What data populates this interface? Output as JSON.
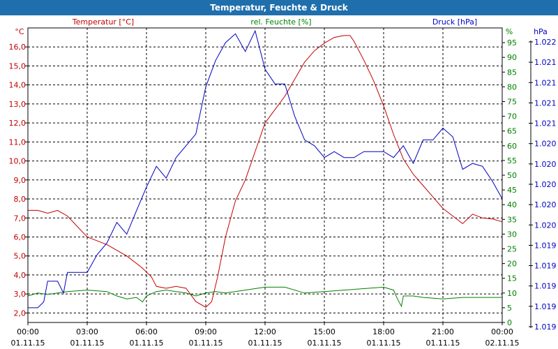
{
  "window": {
    "title": "Temperatur, Feuchte & Druck"
  },
  "colors": {
    "temperature": "#c00000",
    "humidity": "#008000",
    "pressure": "#0000c0",
    "grid": "#000000"
  },
  "chart_data": {
    "type": "line",
    "title": "Temperatur, Feuchte & Druck",
    "grid": true,
    "x_tick_times": [
      "00:00",
      "03:00",
      "06:00",
      "09:00",
      "12:00",
      "15:00",
      "18:00",
      "21:00",
      "00:00"
    ],
    "x_tick_dates": [
      "01.11.15",
      "01.11.15",
      "01.11.15",
      "01.11.15",
      "01.11.15",
      "01.11.15",
      "01.11.15",
      "01.11.15",
      "02.11.15"
    ],
    "x_range_hours": [
      0,
      24
    ],
    "axes": {
      "temperature": {
        "unit": "°C",
        "label": "Temperatur [°C]",
        "range": [
          1.5,
          17.0
        ],
        "ticks": [
          "2,0",
          "3,0",
          "4,0",
          "5,0",
          "6,0",
          "7,0",
          "8,0",
          "9,0",
          "10,0",
          "11,0",
          "12,0",
          "13,0",
          "14,0",
          "15,0",
          "16,0"
        ]
      },
      "humidity": {
        "unit": "%",
        "label": "rel. Feuchte [%]",
        "range": [
          0,
          100
        ],
        "ticks": [
          "0",
          "5",
          "10",
          "15",
          "20",
          "25",
          "30",
          "35",
          "40",
          "45",
          "50",
          "55",
          "60",
          "65",
          "70",
          "75",
          "80",
          "85",
          "90",
          "95"
        ]
      },
      "pressure": {
        "unit": "hPa",
        "label": "Druck [hPa]",
        "ticks": [
          "1.019",
          "1.019",
          "1.019",
          "1.019",
          "1.019",
          "1.020",
          "1.020",
          "1.020",
          "1.020",
          "1.020",
          "1.021",
          "1.021",
          "1.021",
          "1.021",
          "1.022"
        ]
      }
    },
    "series": [
      {
        "name": "Temperatur [°C]",
        "axis": "temperature",
        "x": [
          0,
          0.5,
          1,
          1.5,
          2,
          3,
          4,
          5,
          5.75,
          6.25,
          6.5,
          7,
          7.5,
          8,
          8.5,
          9,
          9.3,
          9.6,
          10,
          10.5,
          11,
          11.5,
          12,
          12.5,
          13,
          13.5,
          14,
          14.5,
          15,
          15.5,
          16,
          16.3,
          16.5,
          17,
          17.5,
          18,
          18.5,
          19,
          19.5,
          20,
          20.5,
          21,
          21.5,
          22,
          22.5,
          23,
          23.5,
          24
        ],
        "values": [
          7.4,
          7.4,
          7.25,
          7.4,
          7.1,
          6.0,
          5.6,
          5.0,
          4.4,
          3.9,
          3.4,
          3.3,
          3.4,
          3.3,
          2.6,
          2.3,
          2.6,
          3.9,
          6.0,
          7.9,
          9.0,
          10.5,
          12.0,
          12.7,
          13.4,
          14.3,
          15.2,
          15.8,
          16.2,
          16.5,
          16.6,
          16.6,
          16.3,
          15.3,
          14.2,
          12.9,
          11.4,
          10.1,
          9.3,
          8.7,
          8.1,
          7.5,
          7.1,
          6.7,
          7.2,
          7.0,
          6.95,
          6.8
        ]
      },
      {
        "name": "rel. Feuchte [%]",
        "axis": "humidity",
        "x": [
          0,
          0.5,
          1,
          2,
          3,
          4,
          4.5,
          5,
          5.5,
          5.8,
          6,
          6.5,
          7,
          8,
          8.5,
          9,
          9.5,
          10,
          11,
          12,
          13,
          14,
          15,
          16,
          17,
          18,
          18.5,
          18.7,
          18.9,
          19,
          19.5,
          20,
          21,
          22,
          23,
          24
        ],
        "values": [
          9,
          10,
          9.5,
          10.5,
          11,
          10.5,
          9,
          8,
          8.5,
          7,
          9,
          10.5,
          11,
          10,
          9,
          10,
          10.5,
          10,
          11,
          12,
          12,
          10,
          10.5,
          11,
          11.5,
          12,
          11,
          8,
          5.5,
          9,
          9,
          8.5,
          8,
          8.5,
          8.5,
          8.5
        ]
      },
      {
        "name": "Druck [hPa]",
        "axis": "pressure",
        "display_scale": [
          0,
          100
        ],
        "x": [
          0,
          0.5,
          0.8,
          1,
          1.5,
          1.8,
          2,
          2.5,
          3,
          3.5,
          4,
          4.5,
          5,
          5.5,
          6,
          6.5,
          7,
          7.5,
          8,
          8.5,
          9,
          9.5,
          10,
          10.5,
          11,
          11.5,
          12,
          12.5,
          13,
          13.5,
          14,
          14.5,
          15,
          15.5,
          16,
          16.5,
          17,
          17.5,
          18,
          18.5,
          19,
          19.5,
          20,
          20.5,
          21,
          21.5,
          22,
          22.5,
          23,
          23.5,
          24
        ],
        "values": [
          5,
          5,
          7,
          14,
          14,
          10,
          17,
          17,
          17,
          23,
          27,
          34,
          30,
          38,
          46,
          53,
          49,
          56,
          60,
          64,
          80,
          89,
          95,
          98,
          92,
          99,
          86,
          81,
          81,
          70,
          62,
          60,
          56,
          58,
          56,
          56,
          58,
          58,
          58,
          56,
          60,
          54,
          62,
          62,
          66,
          63,
          52,
          54,
          53,
          48,
          42
        ]
      }
    ]
  }
}
